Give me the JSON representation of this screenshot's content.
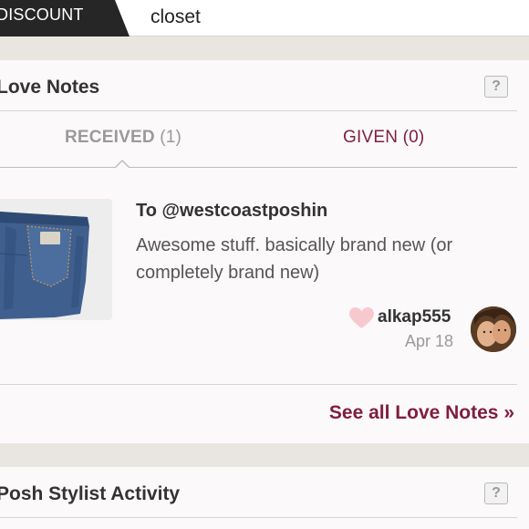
{
  "topbar": {
    "discount_label": "DISCOUNT",
    "closet_label": "closet"
  },
  "love_notes": {
    "title": "Love Notes",
    "help_label": "?",
    "tabs": [
      {
        "name": "RECEIVED",
        "count": "(1)",
        "active": true
      },
      {
        "name": "GIVEN",
        "count": "(0)",
        "active": false
      }
    ],
    "note": {
      "to": "To @westcoastposhin",
      "text": "Awesome stuff. basically brand new (or completely brand new)",
      "user": "alkap555",
      "date": "Apr 18",
      "thumbnail_icon": "jeans-photo",
      "avatar_icon": "user-avatar-photo"
    },
    "see_all": "See all Love Notes »"
  },
  "posh_stylist": {
    "title": "Posh Stylist Activity",
    "help_label": "?"
  },
  "colors": {
    "accent": "#7f1e3e",
    "heart": "#f7c9cf",
    "muted": "#9a9a9a",
    "topbar_tab": "#262626"
  }
}
